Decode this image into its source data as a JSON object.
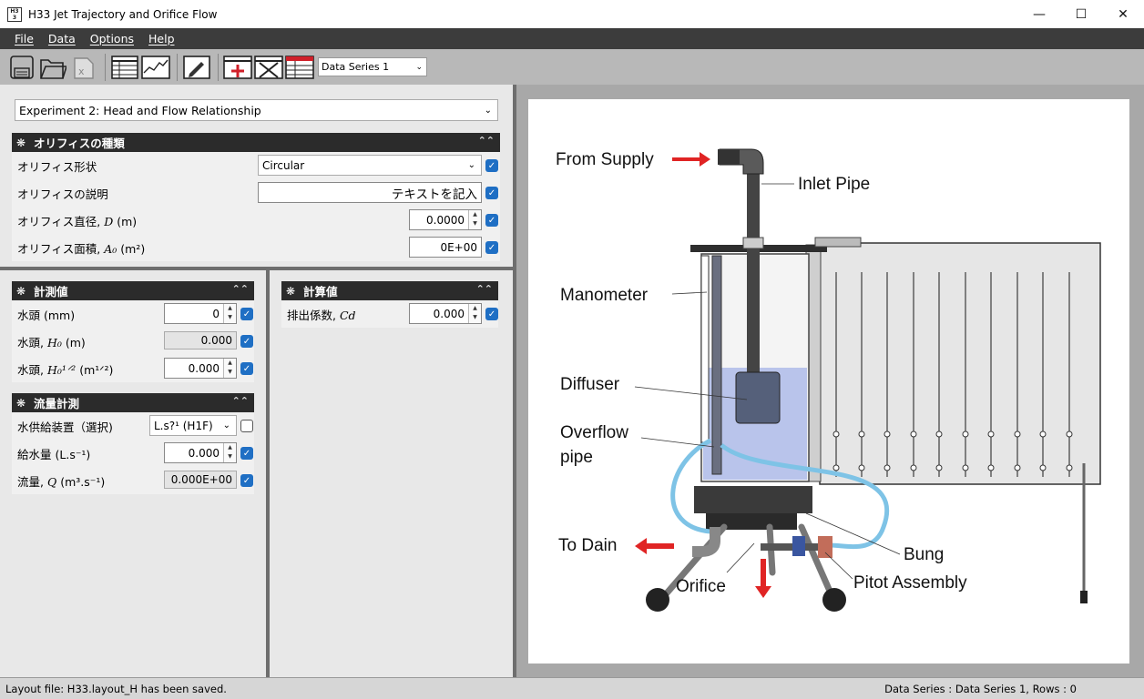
{
  "window": {
    "title": "H33 Jet Trajectory and Orifice Flow",
    "icon_text": "H33"
  },
  "menu": [
    {
      "label": "File"
    },
    {
      "label": "Data"
    },
    {
      "label": "Options"
    },
    {
      "label": "Help"
    }
  ],
  "toolbar": {
    "series_select": "Data Series 1",
    "icons": [
      "save-icon",
      "open-icon",
      "excel-icon",
      "table-icon",
      "chart-icon",
      "edit-icon",
      "add-row-icon",
      "delete-row-icon",
      "series-table-icon"
    ]
  },
  "experiment": {
    "selected": "Experiment 2: Head and Flow Relationship"
  },
  "orifice_group": {
    "title": "オリフィスの種類",
    "rows": [
      {
        "label": "オリフィス形状",
        "value": "Circular"
      },
      {
        "label": "オリフィスの説明",
        "value": "テキストを記入"
      },
      {
        "label": "オリフィス直径,",
        "sym": "D",
        "unit": "(m)",
        "value": "0.0000"
      },
      {
        "label": "オリフィス面積,",
        "sym": "A₀",
        "unit": "(m²)",
        "value": "0E+00"
      }
    ]
  },
  "measured_group": {
    "title": "計測値",
    "rows": [
      {
        "label": "水頭",
        "sym": "",
        "unit": "(mm)",
        "value": "0"
      },
      {
        "label": "水頭,",
        "sym": "H₀",
        "unit": "(m)",
        "value": "0.000"
      },
      {
        "label": "水頭,",
        "sym": "H₀¹ᐟ²",
        "unit": "(m¹ᐟ²)",
        "value": "0.000"
      }
    ]
  },
  "flow_group": {
    "title": "流量計測",
    "rows": [
      {
        "label": "水供給装置（選択)",
        "value": "L.s?¹ (H1F)"
      },
      {
        "label": "給水量",
        "unit": "(L.s⁻¹)",
        "value": "0.000"
      },
      {
        "label": "流量,",
        "sym": "Q",
        "unit": "(m³.s⁻¹)",
        "value": "0.000E+00"
      }
    ]
  },
  "calc_group": {
    "title": "計算値",
    "rows": [
      {
        "label": "排出係数,",
        "sym": "Cd",
        "value": "0.000"
      }
    ]
  },
  "diagram": {
    "labels": {
      "from_supply": "From Supply",
      "inlet_pipe": "Inlet Pipe",
      "manometer": "Manometer",
      "diffuser": "Diffuser",
      "overflow_1": "Overflow",
      "overflow_2": "pipe",
      "to_drain": "To Dain",
      "bung": "Bung",
      "orifice": "Orifice",
      "pitot": "Pitot Assembly"
    },
    "colors": {
      "water": "#aab8e8",
      "arrow": "#e02424",
      "pipe": "#555555"
    }
  },
  "status": {
    "left": "Layout file: H33.layout_H has been saved.",
    "right": "Data Series : Data Series 1,  Rows : 0"
  }
}
